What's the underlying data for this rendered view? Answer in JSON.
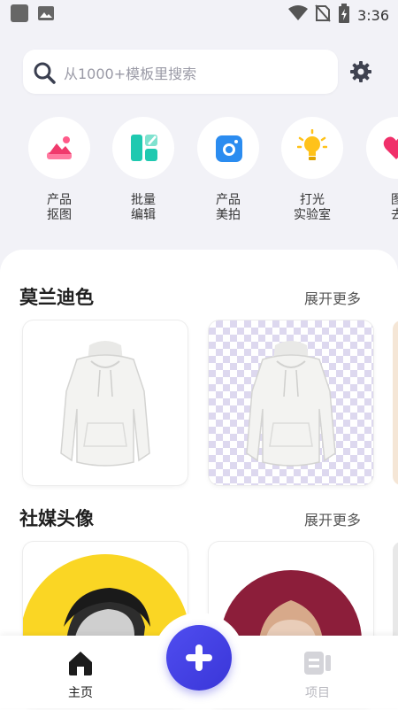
{
  "status_bar": {
    "time": "3:36"
  },
  "search": {
    "placeholder": "从1000+模板里搜索"
  },
  "tools": [
    {
      "label_line1": "产品",
      "label_line2": "抠图",
      "icon": "mountain-image-icon"
    },
    {
      "label_line1": "批量",
      "label_line2": "编辑",
      "icon": "grid-edit-icon"
    },
    {
      "label_line1": "产品",
      "label_line2": "美拍",
      "icon": "camera-icon"
    },
    {
      "label_line1": "打光",
      "label_line2": "实验室",
      "icon": "light-bulb-icon"
    },
    {
      "label_line1": "图",
      "label_line2": "去",
      "icon": "heart-icon"
    }
  ],
  "sections": [
    {
      "title": "莫兰迪色",
      "more": "展开更多"
    },
    {
      "title": "社媒头像",
      "more": "展开更多"
    }
  ],
  "bottom_nav": {
    "home_label": "主页",
    "projects_label": "项目"
  },
  "colors": {
    "accent": "#4643e6",
    "yellow": "#fad624",
    "maroon": "#8c1e3a"
  }
}
